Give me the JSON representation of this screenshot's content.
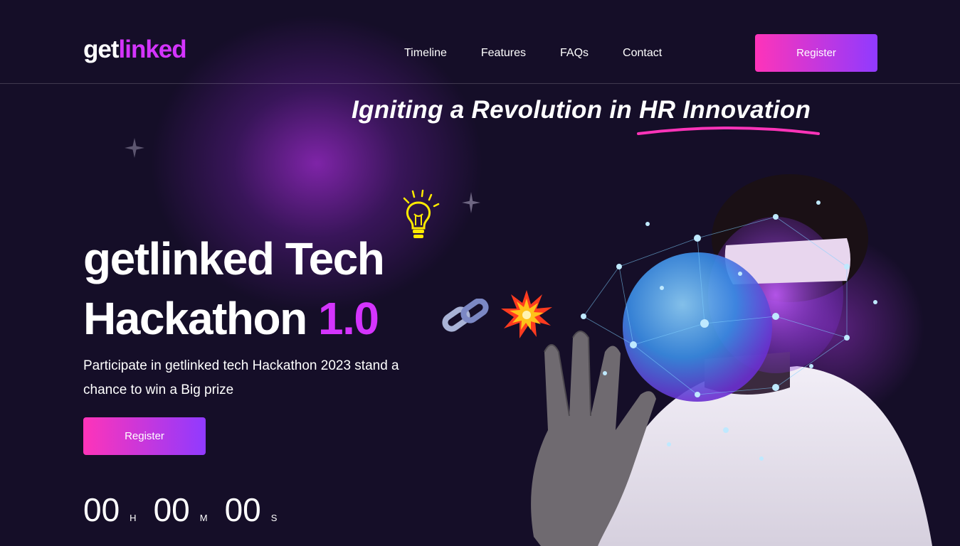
{
  "brand": {
    "part1": "get",
    "part2": "linked"
  },
  "nav": {
    "timeline": "Timeline",
    "features": "Features",
    "faqs": "FAQs",
    "contact": "Contact",
    "register": "Register"
  },
  "hero": {
    "tagline": "Igniting a Revolution in HR Innovation",
    "title_line1": "getlinked Tech",
    "title_line2_word": "Hackathon",
    "title_version": "1.0",
    "description": "Participate in getlinked tech Hackathon 2023 stand a chance to win a Big prize",
    "register": "Register"
  },
  "countdown": {
    "hours": "00",
    "hours_unit": "H",
    "minutes": "00",
    "minutes_unit": "M",
    "seconds": "00",
    "seconds_unit": "S"
  },
  "icons": [
    "sparkle-star-icon",
    "lightbulb-icon",
    "chain-link-icon",
    "explosion-icon"
  ],
  "colors": {
    "accent_pink": "#fe34b9",
    "accent_purple": "#903aff",
    "brand_purple": "#d434fe",
    "background": "#150e28"
  }
}
